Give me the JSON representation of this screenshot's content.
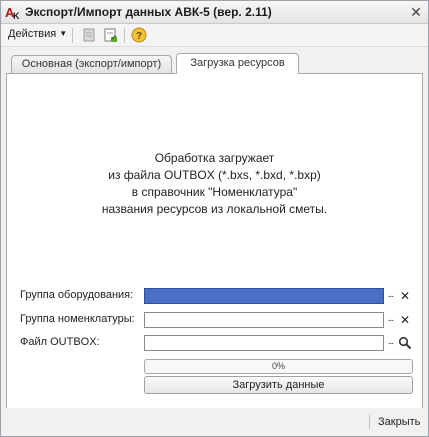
{
  "window": {
    "title": "Экспорт/Импорт данных АВК-5 (вер. 2.11)"
  },
  "toolbar": {
    "actions_label": "Действия",
    "icons": [
      "properties-icon",
      "export-icon",
      "help-icon"
    ]
  },
  "tabs": [
    {
      "label": "Основная (экспорт/импорт)",
      "active": false
    },
    {
      "label": "Загрузка ресурсов",
      "active": true
    }
  ],
  "info": {
    "lines": [
      "Обработка загружает",
      "из файла OUTBOX (*.bxs, *.bxd, *.bxp)",
      "в справочник \"Номенклатура\"",
      "названия ресурсов из локальной сметы."
    ]
  },
  "fields": {
    "equipment_group": {
      "label": "Группа оборудования:",
      "value": ""
    },
    "nomenclature_group": {
      "label": "Группа номенклатуры:",
      "value": ""
    },
    "outbox_file": {
      "label": "Файл OUTBOX:",
      "value": ""
    }
  },
  "buttons": {
    "select_label": "...",
    "clear_symbol": "✕"
  },
  "progress": {
    "value": 0,
    "text": "0%"
  },
  "load_button": {
    "label": "Загрузить данные"
  },
  "footer": {
    "close_label": "Закрыть"
  },
  "colors": {
    "selected_field": "#4a6fc6",
    "window_bg": "#f1f1f1",
    "panel_bg": "#ffffff"
  }
}
